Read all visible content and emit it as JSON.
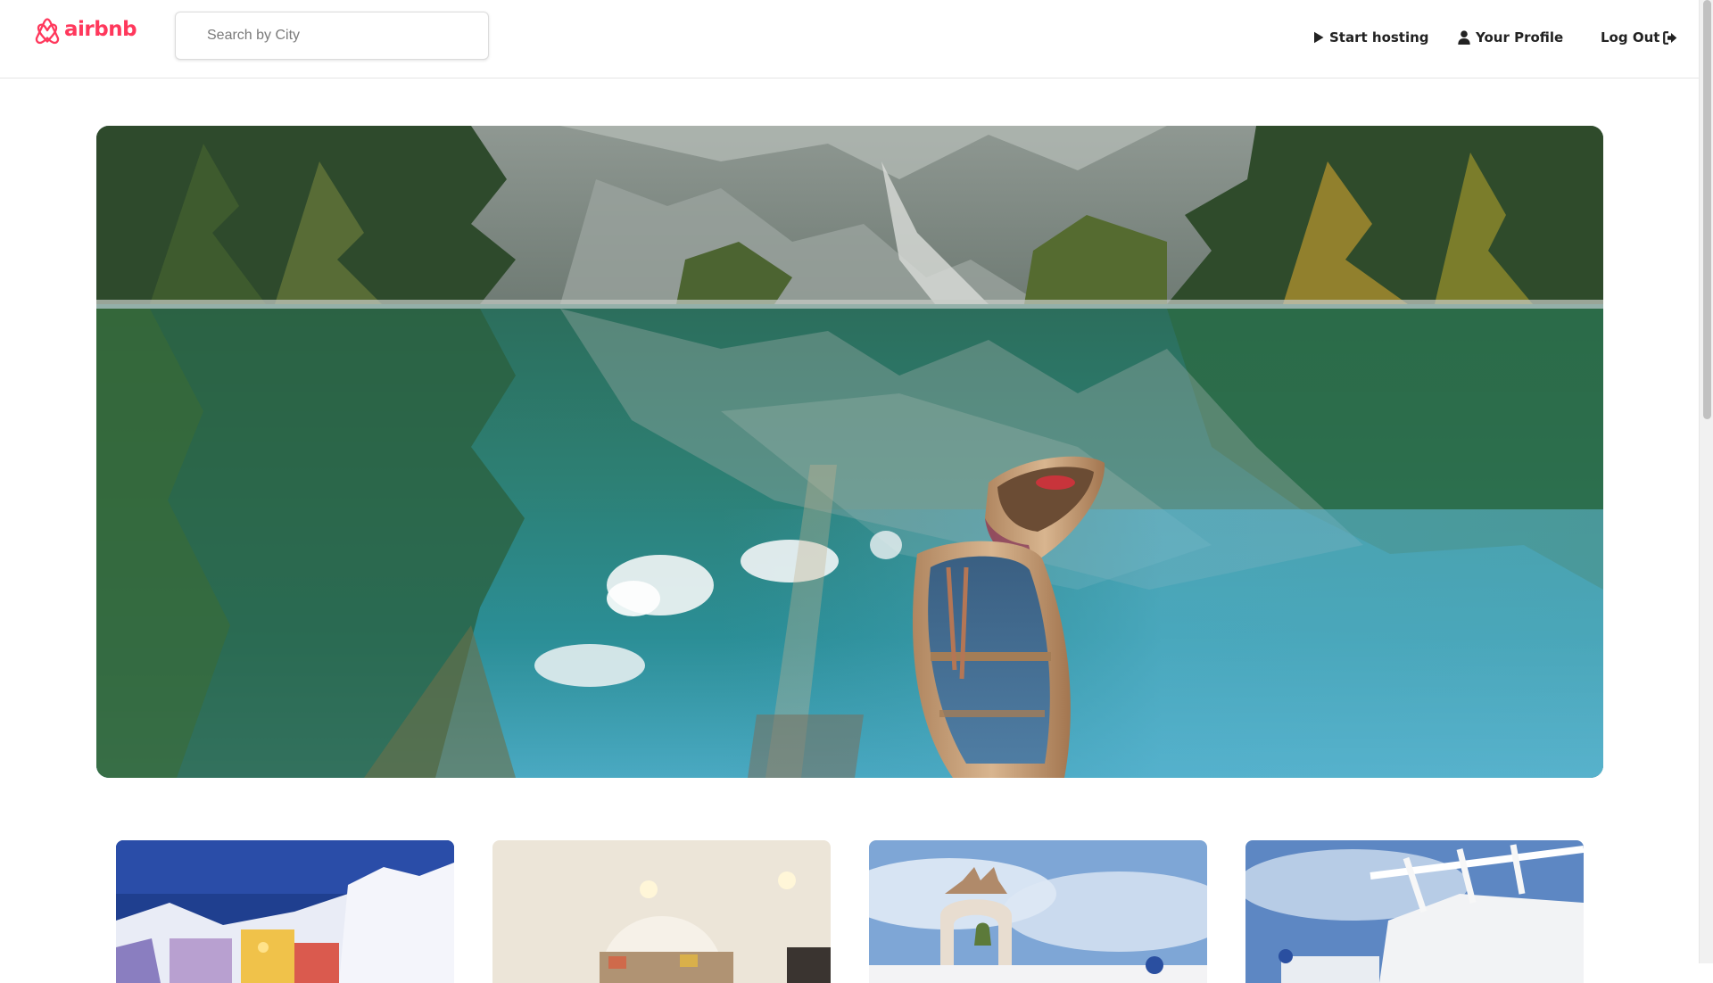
{
  "app": {
    "logo_text": "airbnb",
    "brand_color": "#ff385c"
  },
  "search": {
    "placeholder": "Search by City",
    "value": ""
  },
  "nav": {
    "start_hosting": {
      "label": "Start hosting",
      "icon": "play-icon"
    },
    "profile": {
      "label": "Your Profile",
      "icon": "user-icon"
    },
    "logout": {
      "label": "Log Out",
      "icon": "sign-out-icon"
    }
  },
  "hero": {
    "subject": "mountain-lake-with-rowboats"
  },
  "listings": [
    {
      "image": "santorini-dusk-terraces"
    },
    {
      "image": "cave-bedroom-interior"
    },
    {
      "image": "bell-tower-arch"
    },
    {
      "image": "white-pergola-terrace"
    }
  ]
}
